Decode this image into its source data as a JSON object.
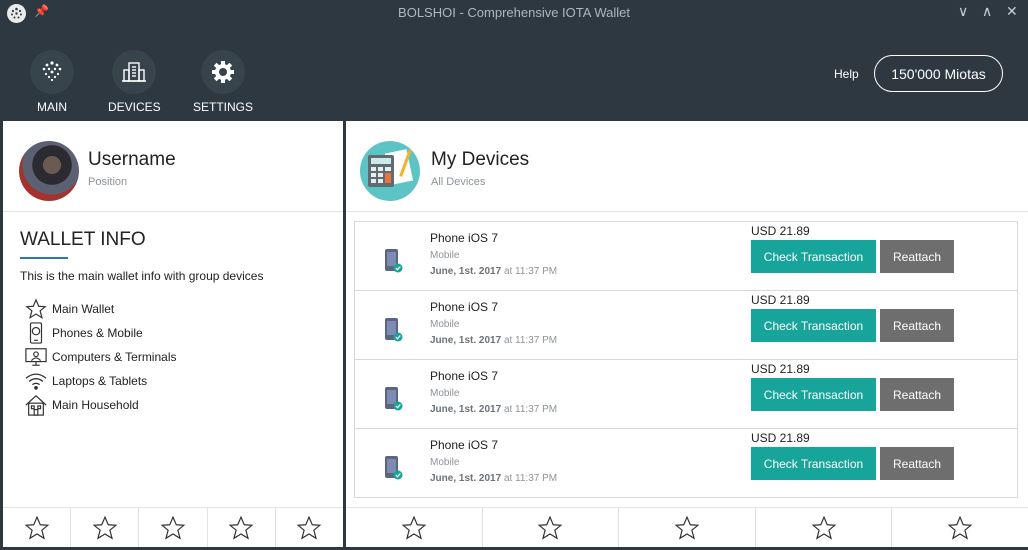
{
  "window": {
    "title": "BOLSHOI - Comprehensive IOTA Wallet"
  },
  "nav": [
    {
      "label": "MAIN",
      "icon": "iota-logo-icon"
    },
    {
      "label": "DEVICES",
      "icon": "building-icon"
    },
    {
      "label": "SETTINGS",
      "icon": "gear-icon"
    }
  ],
  "header": {
    "help_label": "Help",
    "balance": "150'000 Miotas"
  },
  "profile": {
    "name": "Username",
    "position": "Position"
  },
  "wallet_info": {
    "title": "WALLET INFO",
    "description": "This is the main wallet info with group devices",
    "groups": [
      {
        "label": "Main Wallet",
        "icon": "star-icon"
      },
      {
        "label": "Phones & Mobile",
        "icon": "phone-icon"
      },
      {
        "label": "Computers & Terminals",
        "icon": "computer-icon"
      },
      {
        "label": "Laptops & Tablets",
        "icon": "wifi-icon"
      },
      {
        "label": "Main Household",
        "icon": "house-icon"
      }
    ]
  },
  "devices_panel": {
    "title": "My Devices",
    "subtitle": "All Devices",
    "items": [
      {
        "name": "Phone iOS 7",
        "type": "Mobile",
        "date": "June, 1st. 2017",
        "time": "at 11:37 PM",
        "price": "USD 21.89",
        "check_label": "Check Transaction",
        "reattach_label": "Reattach"
      },
      {
        "name": "Phone iOS 7",
        "type": "Mobile",
        "date": "June, 1st. 2017",
        "time": "at 11:37 PM",
        "price": "USD 21.89",
        "check_label": "Check Transaction",
        "reattach_label": "Reattach"
      },
      {
        "name": "Phone iOS 7",
        "type": "Mobile",
        "date": "June, 1st. 2017",
        "time": "at 11:37 PM",
        "price": "USD 21.89",
        "check_label": "Check Transaction",
        "reattach_label": "Reattach"
      },
      {
        "name": "Phone iOS 7",
        "type": "Mobile",
        "date": "June, 1st. 2017",
        "time": "at 11:37 PM",
        "price": "USD 21.89",
        "check_label": "Check Transaction",
        "reattach_label": "Reattach"
      }
    ]
  },
  "colors": {
    "accent": "#17a49a",
    "secondary_button": "#6e6e6e",
    "header_bg": "#2d3840"
  }
}
